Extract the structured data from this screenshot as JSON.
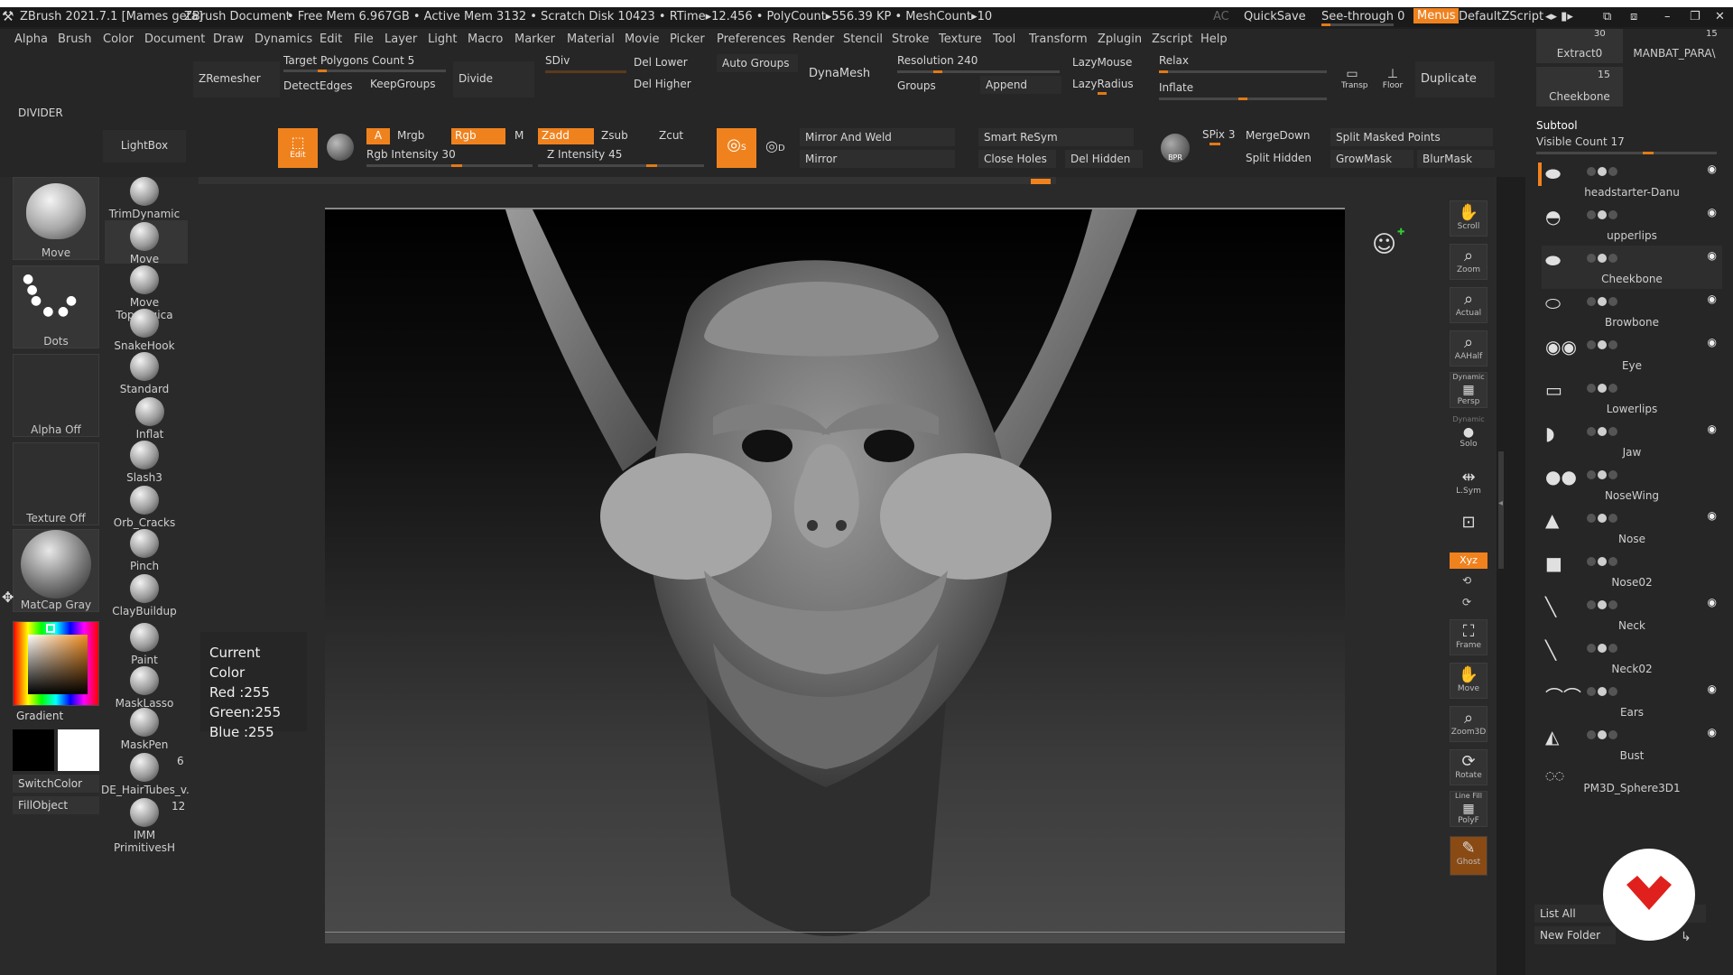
{
  "title_bar": {
    "app": "ZBrush 2021.7.1 [Mames geta]",
    "doc": "ZBrush Document",
    "stats": "• Free Mem 6.967GB • Active Mem 3132 • Scratch Disk 10423 • RTime▸12.456 • PolyCount▸556.39 KP • MeshCount▸10",
    "ac": "AC",
    "quicksave": "QuickSave",
    "see_through": "See-through  0",
    "menus": "Menus",
    "default_zscript": "DefaultZScript"
  },
  "menu": [
    "Alpha",
    "Brush",
    "Color",
    "Document",
    "Draw",
    "Dynamics",
    "Edit",
    "File",
    "Layer",
    "Light",
    "Macro",
    "Marker",
    "Material",
    "Movie",
    "Picker",
    "Preferences",
    "Render",
    "Stencil",
    "Stroke",
    "Texture",
    "Tool",
    "Transform",
    "Zplugin",
    "Zscript",
    "Help"
  ],
  "palette": {
    "zremesher": "ZRemesher",
    "target_polygons": "Target Polygons Count 5",
    "detect_edges": "DetectEdges",
    "keep_groups": "KeepGroups",
    "divide": "Divide",
    "sdiv": "SDiv",
    "del_lower": "Del Lower",
    "del_higher": "Del Higher",
    "auto_groups": "Auto Groups",
    "dynamesh": "DynaMesh",
    "resolution": "Resolution 240",
    "groups": "Groups",
    "append": "Append",
    "lazymouse": "LazyMouse",
    "lazyradius": "LazyRadius",
    "relax": "Relax",
    "inflate": "Inflate",
    "transp": "Transp",
    "floor": "Floor",
    "duplicate": "Duplicate",
    "divider": "DIVIDER",
    "lightbox": "LightBox",
    "edit": "Edit",
    "a": "A",
    "mrgb": "Mrgb",
    "rgb": "Rgb",
    "m": "M",
    "rgb_intensity": "Rgb Intensity 30",
    "zadd": "Zadd",
    "zsub": "Zsub",
    "zcut": "Zcut",
    "z_intensity": "Z Intensity 45",
    "s": "S",
    "d": "D",
    "mirror_weld": "Mirror And Weld",
    "mirror": "Mirror",
    "smart_resym": "Smart ReSym",
    "close_holes": "Close Holes",
    "del_hidden": "Del Hidden",
    "bpr": "BPR",
    "spix": "SPix 3",
    "mergedown": "MergeDown",
    "split_hidden": "Split Hidden",
    "split_masked": "Split Masked Points",
    "growmask": "GrowMask",
    "blurmask": "BlurMask"
  },
  "left_tiles": {
    "move": "Move",
    "dots": "Dots",
    "alpha_off": "Alpha Off",
    "texture_off": "Texture Off",
    "matcap": "MatCap Gray",
    "gradient": "Gradient",
    "switchcolor": "SwitchColor",
    "fillobject": "FillObject"
  },
  "brushes": [
    {
      "label": "TrimDynamic"
    },
    {
      "label": "Move"
    },
    {
      "label": "Move Topologica"
    },
    {
      "label": "SnakeHook"
    },
    {
      "label": "Standard"
    },
    {
      "label": "Inflat"
    },
    {
      "label": "Slash3"
    },
    {
      "label": "Orb_Cracks"
    },
    {
      "label": "Pinch"
    },
    {
      "label": "ClayBuildup"
    },
    {
      "label": "Paint"
    },
    {
      "label": "MaskLasso"
    },
    {
      "label": "MaskPen"
    },
    {
      "label": "DE_HairTubes_v."
    },
    {
      "label": "IMM PrimitivesH"
    }
  ],
  "brush_counts": {
    "hairtubes": "6",
    "imm": "12"
  },
  "current_color": {
    "title": "Current Color",
    "red": "Red :255",
    "green": "Green:255",
    "blue": "Blue :255"
  },
  "nav": [
    "Scroll",
    "Zoom",
    "Actual",
    "AAHalf",
    "Persp",
    "Solo",
    "L.Sym",
    "Xyz",
    "Frame",
    "Move",
    "Zoom3D",
    "Rotate",
    "PolyF",
    "Ghost"
  ],
  "nav_extra": {
    "dynamic1": "Dynamic",
    "dynamic2": "Dynamic",
    "linefill": "Line Fill"
  },
  "subtool": {
    "top_items": [
      "Extract0",
      "MANBAT_PARA\\",
      "Cheekbone"
    ],
    "top_counts": [
      "30",
      "15",
      "15"
    ],
    "header": "Subtool",
    "visible_count": "Visible Count 17",
    "items": [
      "headstarter-Danu",
      "upperlips",
      "Cheekbone",
      "Browbone",
      "Eye",
      "Lowerlips",
      "Jaw",
      "NoseWing",
      "Nose",
      "Nose02",
      "Neck",
      "Neck02",
      "Ears",
      "Bust",
      "PM3D_Sphere3D1"
    ],
    "list_all": "List All",
    "new_folder": "New Folder"
  },
  "colors": {
    "accent": "#f0821e",
    "panel": "#262626",
    "panel_dark": "#1e1e1e",
    "logo_red": "#e0201c"
  }
}
